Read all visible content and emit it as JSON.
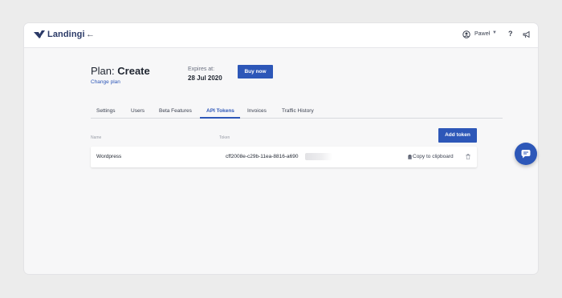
{
  "header": {
    "logo_text": "Landingi",
    "user_name": "Paweł",
    "help_label": "?"
  },
  "plan": {
    "label": "Plan:",
    "name": "Create",
    "change_plan": "Change plan",
    "expires_label": "Expires at:",
    "expires_date": "28 Jul 2020",
    "buy_now": "Buy now"
  },
  "tabs": [
    {
      "label": "Settings",
      "active": false
    },
    {
      "label": "Users",
      "active": false
    },
    {
      "label": "Beta Features",
      "active": false
    },
    {
      "label": "API Tokens",
      "active": true
    },
    {
      "label": "Invoices",
      "active": false
    },
    {
      "label": "Traffic History",
      "active": false
    }
  ],
  "table": {
    "col_name": "Name",
    "col_token": "Token",
    "add_token": "Add token",
    "rows": [
      {
        "name": "Wordpress",
        "token": "cff2008e-c29b-11ea-8816-a690",
        "copy_label": "Copy to clipboard"
      }
    ]
  },
  "icons": {
    "back": "arrow-left-icon",
    "user": "user-icon",
    "announce": "megaphone-icon",
    "copy": "clipboard-icon",
    "delete": "trash-icon",
    "chat": "chat-icon"
  },
  "colors": {
    "accent": "#2d57b8",
    "logo": "#2b3a67",
    "background": "#f7f7f8"
  }
}
